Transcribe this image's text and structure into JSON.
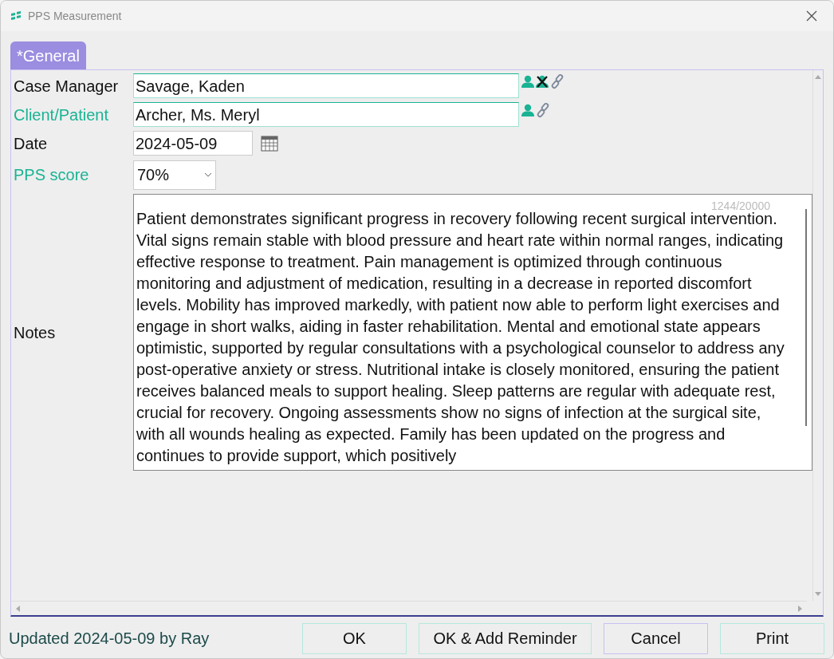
{
  "window": {
    "title": "PPS Measurement"
  },
  "tabs": [
    {
      "label": "*General",
      "selected": true
    }
  ],
  "fields": [
    {
      "kind": "person",
      "label": "Case Manager",
      "required": false,
      "value": "Savage, Kaden",
      "clearable": true
    },
    {
      "kind": "person",
      "label": "Client/Patient",
      "required": true,
      "value": "Archer, Ms. Meryl",
      "clearable": false
    },
    {
      "kind": "date",
      "label": "Date",
      "required": false,
      "value": "2024-05-09"
    },
    {
      "kind": "select",
      "label": "PPS score",
      "required": true,
      "value": "70%"
    },
    {
      "kind": "notes",
      "label": "Notes",
      "required": false,
      "counter": "1244/20000",
      "value": "Patient demonstrates significant progress in recovery following recent surgical intervention. Vital signs remain stable with blood pressure and heart rate within normal ranges, indicating effective response to treatment. Pain management is optimized through continuous monitoring and adjustment of medication, resulting in a decrease in reported discomfort levels. Mobility has improved markedly, with patient now able to perform light exercises and engage in short walks, aiding in faster rehabilitation. Mental and emotional state appears optimistic, supported by regular consultations with a psychological counselor to address any post-operative anxiety or stress. Nutritional intake is closely monitored, ensuring the patient receives balanced meals to support healing. Sleep patterns are regular with adequate rest, crucial for recovery. Ongoing assessments show no signs of infection at the surgical site, with all wounds healing as expected. Family has been updated on the progress and continues to provide support, which positively"
    }
  ],
  "status": "Updated 2024-05-09 by Ray",
  "buttons": [
    "OK",
    "OK & Add Reminder",
    "Cancel",
    "Print"
  ]
}
